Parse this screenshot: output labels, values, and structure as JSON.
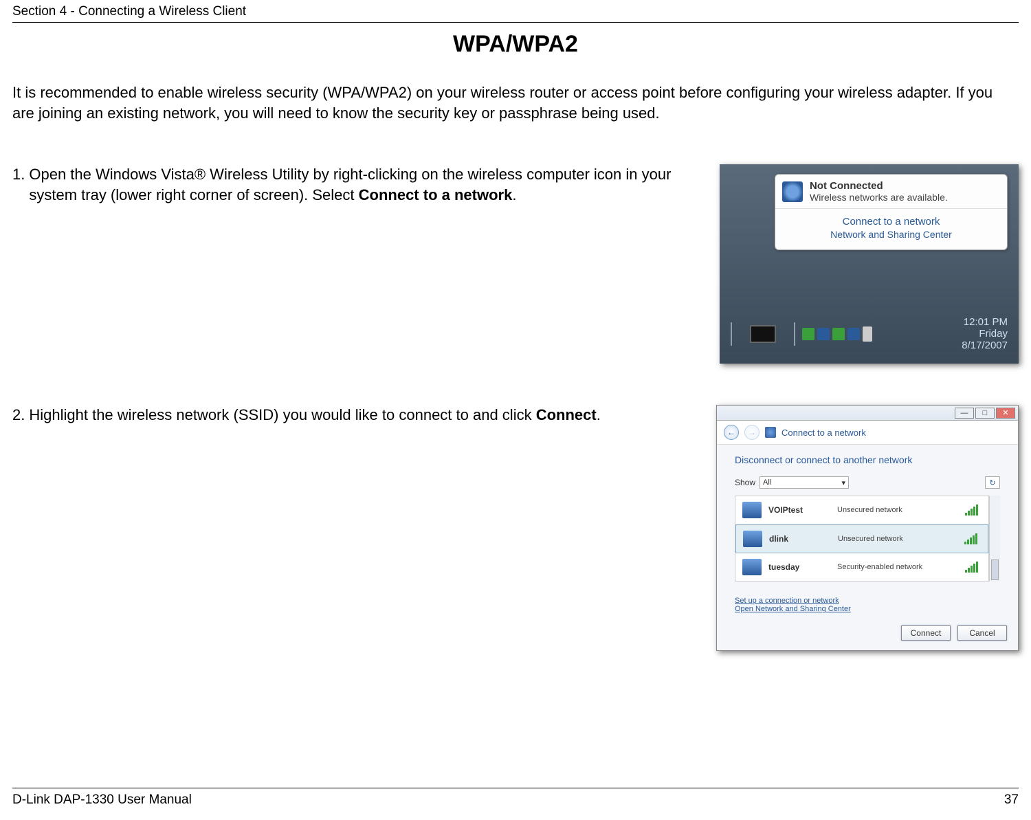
{
  "header": {
    "section": "Section 4 - Connecting a Wireless Client"
  },
  "title": "WPA/WPA2",
  "intro": "It is recommended to enable wireless security (WPA/WPA2) on your wireless router or access point before configuring your wireless adapter. If you are joining an existing network, you will need to know the security key or passphrase being used.",
  "steps": {
    "one": {
      "num": "1.",
      "pre": "Open the Windows Vista® Wireless Utility by right-clicking on the wireless computer icon in your system tray (lower right corner of screen). Select ",
      "bold": "Connect to a network",
      "post": "."
    },
    "two": {
      "num": "2.",
      "pre": "Highlight the wireless network (SSID) you would like to connect to and click ",
      "bold": "Connect",
      "post": "."
    }
  },
  "shot1": {
    "balloon_title": "Not Connected",
    "balloon_msg": "Wireless networks are available.",
    "connect": "Connect to a network",
    "nasc": "Network and Sharing Center",
    "clock_time": "12:01 PM",
    "clock_day": "Friday",
    "clock_date": "8/17/2007"
  },
  "shot2": {
    "window_title": "Connect to a network",
    "heading": "Disconnect or connect to another network",
    "show_label": "Show",
    "show_value": "All",
    "networks": [
      {
        "ssid": "VOIPtest",
        "status": "Unsecured network"
      },
      {
        "ssid": "dlink",
        "status": "Unsecured network"
      },
      {
        "ssid": "tuesday",
        "status": "Security-enabled network"
      }
    ],
    "link1": "Set up a connection or network",
    "link2": "Open Network and Sharing Center",
    "btn_connect": "Connect",
    "btn_cancel": "Cancel"
  },
  "footer": {
    "left": "D-Link DAP-1330 User Manual",
    "page": "37"
  }
}
